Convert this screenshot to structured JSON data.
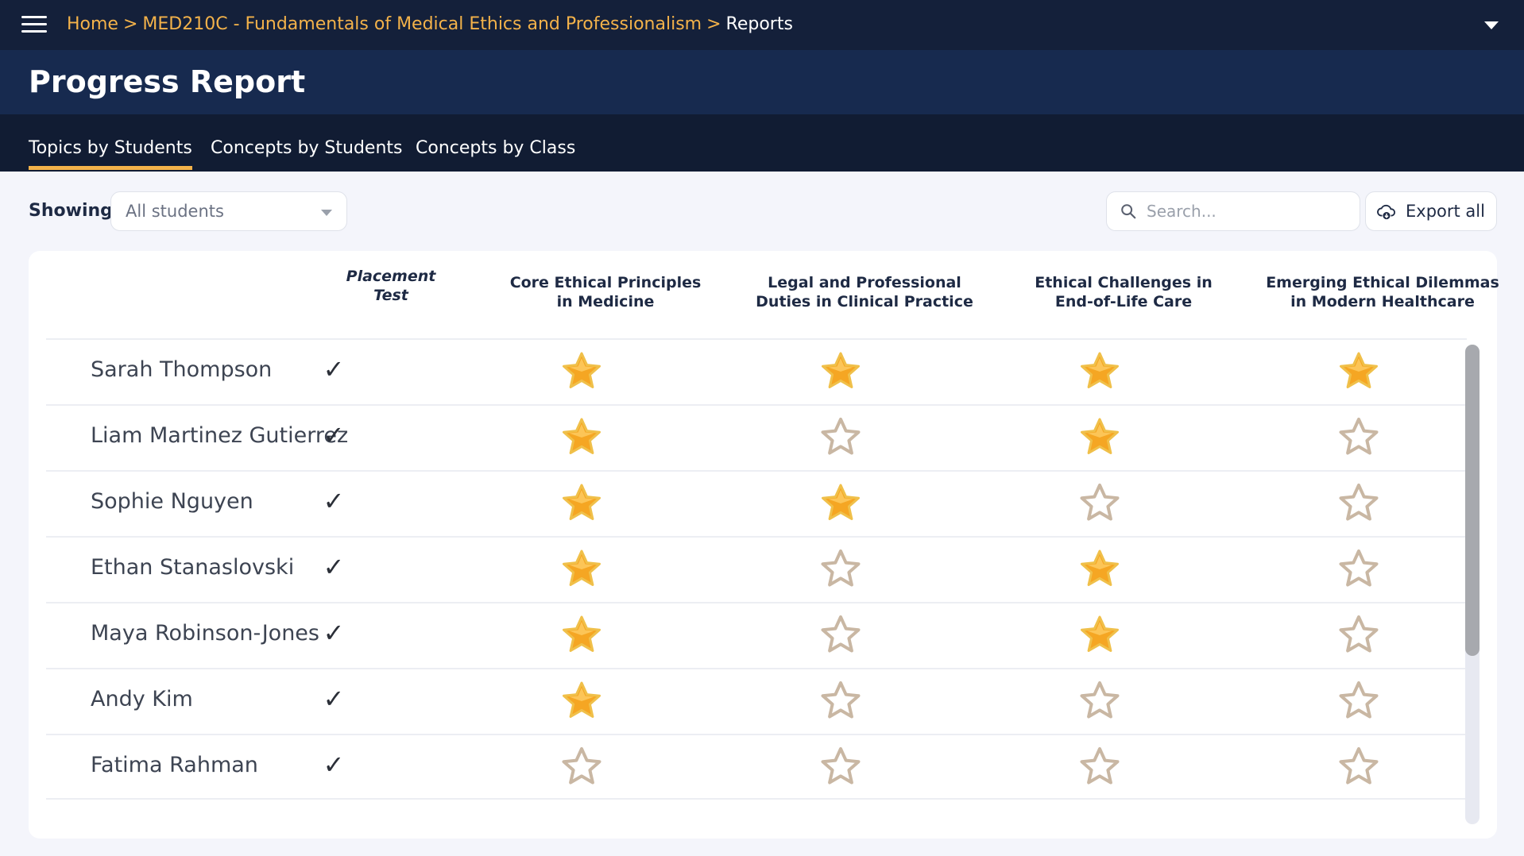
{
  "breadcrumb": {
    "home": "Home",
    "sep1": ">",
    "course": "MED210C - Fundamentals of Medical Ethics and Professionalism",
    "sep2": ">",
    "current": "Reports"
  },
  "page_title": "Progress Report",
  "tabs": [
    {
      "label": "Topics by Students",
      "active": true
    },
    {
      "label": "Concepts by Students",
      "active": false
    },
    {
      "label": "Concepts by Class",
      "active": false
    }
  ],
  "filter": {
    "label": "Showing",
    "selected": "All students"
  },
  "search": {
    "placeholder": "Search..."
  },
  "export": {
    "label": "Export all"
  },
  "table": {
    "placement_header_line1": "Placement",
    "placement_header_line2": "Test",
    "topics": [
      {
        "line1": "Core Ethical Principles",
        "line2": "in Medicine"
      },
      {
        "line1": "Legal and Professional",
        "line2": "Duties in Clinical Practice"
      },
      {
        "line1": "Ethical Challenges in",
        "line2": "End-of-Life Care"
      },
      {
        "line1": "Emerging Ethical Dilemmas",
        "line2": "in Modern Healthcare"
      }
    ],
    "check_glyph": "✓",
    "students": [
      {
        "name": "Sarah Thompson",
        "placement_done": true,
        "stars": [
          true,
          true,
          true,
          true
        ]
      },
      {
        "name": "Liam Martinez Gutierrez",
        "placement_done": true,
        "stars": [
          true,
          false,
          true,
          false
        ]
      },
      {
        "name": "Sophie Nguyen",
        "placement_done": true,
        "stars": [
          true,
          true,
          false,
          false
        ]
      },
      {
        "name": "Ethan  Stanaslovski",
        "placement_done": true,
        "stars": [
          true,
          false,
          true,
          false
        ]
      },
      {
        "name": "Maya Robinson-Jones",
        "placement_done": true,
        "stars": [
          true,
          false,
          true,
          false
        ]
      },
      {
        "name": "Andy Kim",
        "placement_done": true,
        "stars": [
          true,
          false,
          false,
          false
        ]
      },
      {
        "name": "Fatima Rahman",
        "placement_done": true,
        "stars": [
          false,
          false,
          false,
          false
        ]
      }
    ]
  },
  "colors": {
    "nav_bg": "#14203a",
    "title_bg": "#172a4f",
    "accent": "#f3b24a",
    "star_filled": "#f5a623",
    "star_empty": "#c9b7a3"
  }
}
